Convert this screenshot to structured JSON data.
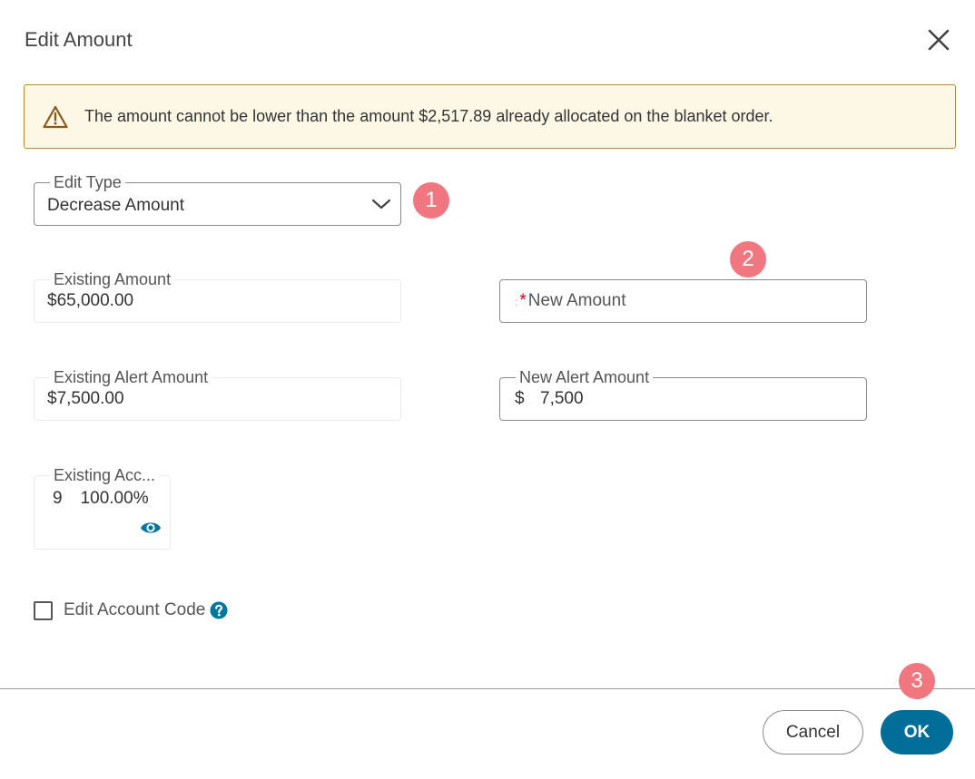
{
  "dialog": {
    "title": "Edit Amount",
    "close_icon": "close-icon"
  },
  "warning": {
    "icon": "warning-triangle-icon",
    "text": "The amount cannot be lower than the amount $2,517.89 already allocated on the blanket order."
  },
  "edit_type": {
    "label": "Edit Type",
    "value": "Decrease Amount",
    "icon": "chevron-down-icon"
  },
  "existing_amount": {
    "label": "Existing Amount",
    "value": "$65,000.00"
  },
  "new_amount": {
    "required_marker": "*",
    "placeholder": "New Amount",
    "value": ""
  },
  "existing_alert_amount": {
    "label": "Existing Alert Amount",
    "value": "$7,500.00"
  },
  "new_alert_amount": {
    "label": "New Alert Amount",
    "currency": "$",
    "value": "7,500"
  },
  "existing_account": {
    "label": "Existing Acc...",
    "number": "9",
    "percent": "100.00%",
    "icon": "eye-icon"
  },
  "edit_account_code": {
    "label": "Edit Account Code",
    "checked": false,
    "help_icon": "help-icon"
  },
  "annotations": {
    "badge_1": "1",
    "badge_2": "2",
    "badge_3": "3"
  },
  "footer": {
    "cancel_label": "Cancel",
    "ok_label": "OK"
  },
  "colors": {
    "primary": "#006e99",
    "warning_bg": "#fdf8e6",
    "warning_border": "#b58a3c",
    "badge": "#f0767f",
    "required": "#d0021b"
  }
}
